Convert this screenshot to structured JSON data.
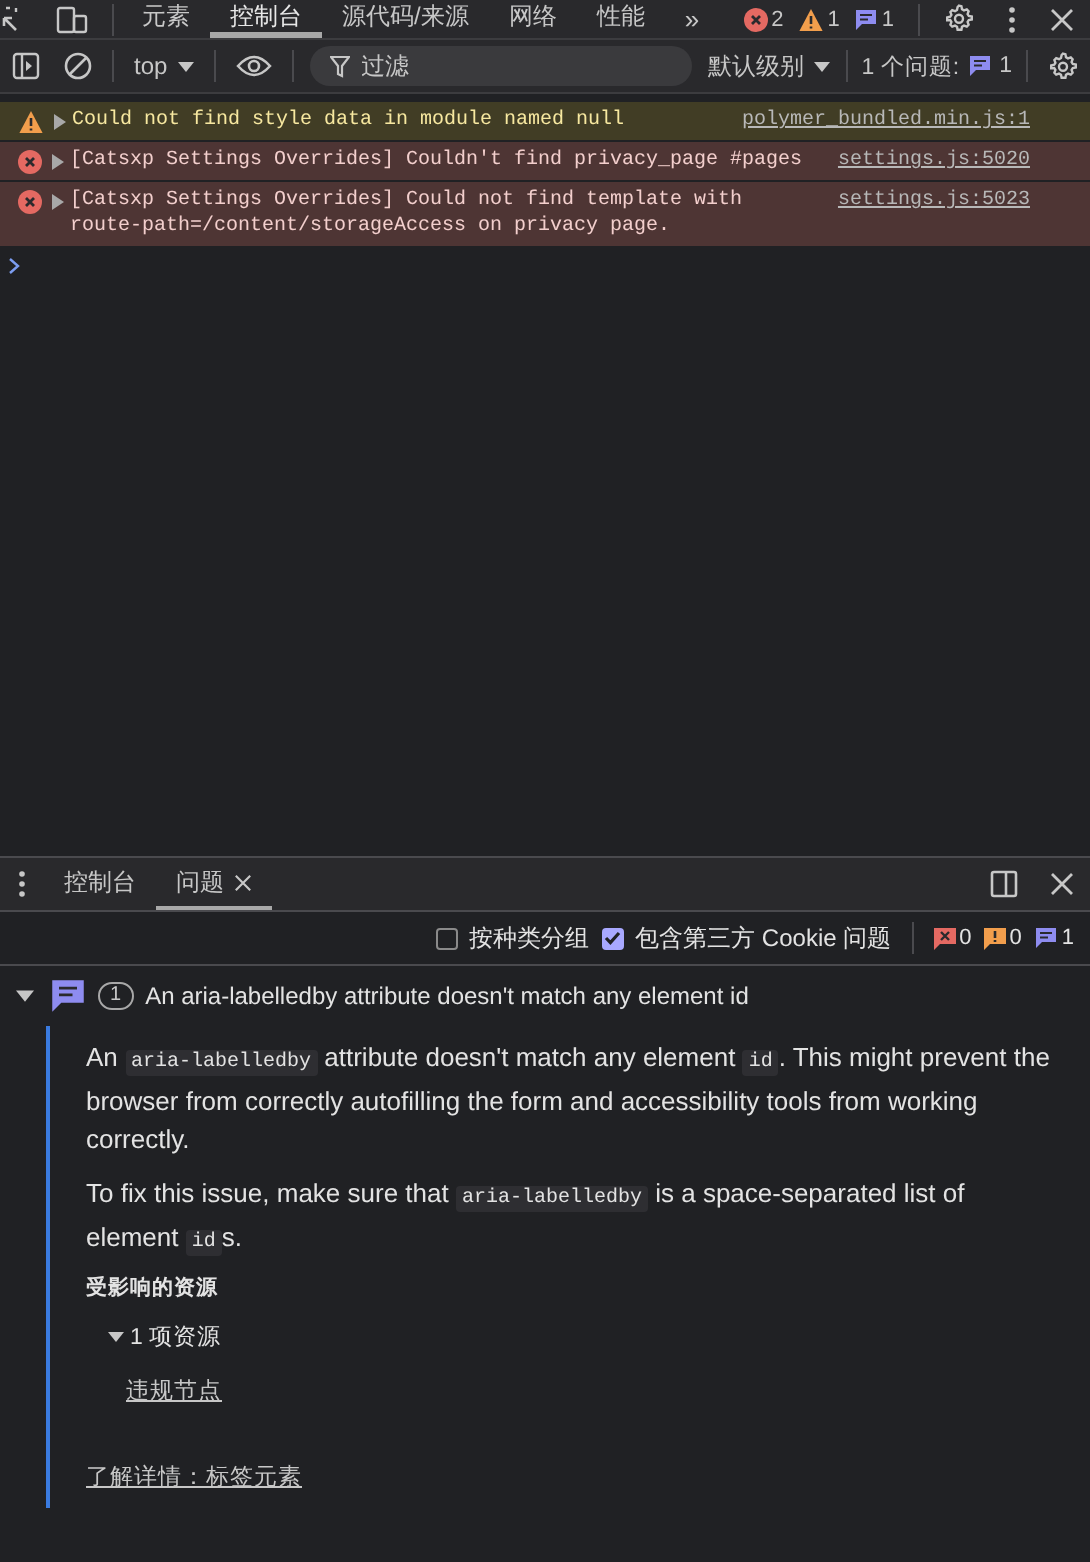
{
  "main_tabs": [
    {
      "label": "元素",
      "selected": false
    },
    {
      "label": "控制台",
      "selected": true
    },
    {
      "label": "源代码/来源",
      "selected": false
    },
    {
      "label": "网络",
      "selected": false
    },
    {
      "label": "性能",
      "selected": false
    }
  ],
  "more_tabs": "»",
  "counters": [
    {
      "kind": "error",
      "count": "2"
    },
    {
      "kind": "warning",
      "count": "1"
    },
    {
      "kind": "info",
      "count": "1"
    }
  ],
  "toolbar": {
    "context": "top",
    "filter_placeholder": "过滤",
    "level": "默认级别",
    "issues_label": "1 个问题:",
    "issues_count": "1"
  },
  "messages": [
    {
      "kind": "warning",
      "text": "Could not find style data in module named null",
      "source": "polymer_bundled.min.js:1"
    },
    {
      "kind": "error",
      "text": "[Catsxp Settings Overrides] Couldn't find privacy_page #pages",
      "source": "settings.js:5020"
    },
    {
      "kind": "error",
      "text": "[Catsxp Settings Overrides] Could not find template with route-path=/content/storageAccess on privacy page.",
      "source": "settings.js:5023"
    }
  ],
  "drawer_tabs": [
    {
      "label": "控制台",
      "selected": false,
      "closable": false
    },
    {
      "label": "问题",
      "selected": true,
      "closable": true
    }
  ],
  "issues_toolbar": {
    "options": [
      {
        "label": "按种类分组",
        "checked": false
      },
      {
        "label": "包含第三方 Cookie 问题",
        "checked": true
      }
    ],
    "counts": [
      {
        "kind": "error",
        "count": "0"
      },
      {
        "kind": "warning",
        "count": "0"
      },
      {
        "kind": "info",
        "count": "1"
      }
    ]
  },
  "issue": {
    "expanded": true,
    "count": "1",
    "title": "An aria-labelledby attribute doesn't match any element id",
    "paragraphs": [
      [
        {
          "kind": "text",
          "text": "An "
        },
        {
          "kind": "code",
          "text": "aria-labelledby"
        },
        {
          "kind": "text",
          "text": " attribute doesn't match any element "
        },
        {
          "kind": "code",
          "text": "id"
        },
        {
          "kind": "text",
          "text": ". This might prevent the browser from correctly autofilling the form and accessibility tools from working correctly."
        }
      ],
      [
        {
          "kind": "text",
          "text": "To fix this issue, make sure that "
        },
        {
          "kind": "code",
          "text": "aria-labelledby"
        },
        {
          "kind": "text",
          "text": " is a space-separated list of element "
        },
        {
          "kind": "code",
          "text": "id"
        },
        {
          "kind": "text",
          "text": "s."
        }
      ]
    ],
    "resources_heading": "受影响的资源",
    "resources_toggle": "1 项资源",
    "resources_expanded": true,
    "resource_link": "违规节点",
    "learn_more": "了解详情：标签元素"
  }
}
